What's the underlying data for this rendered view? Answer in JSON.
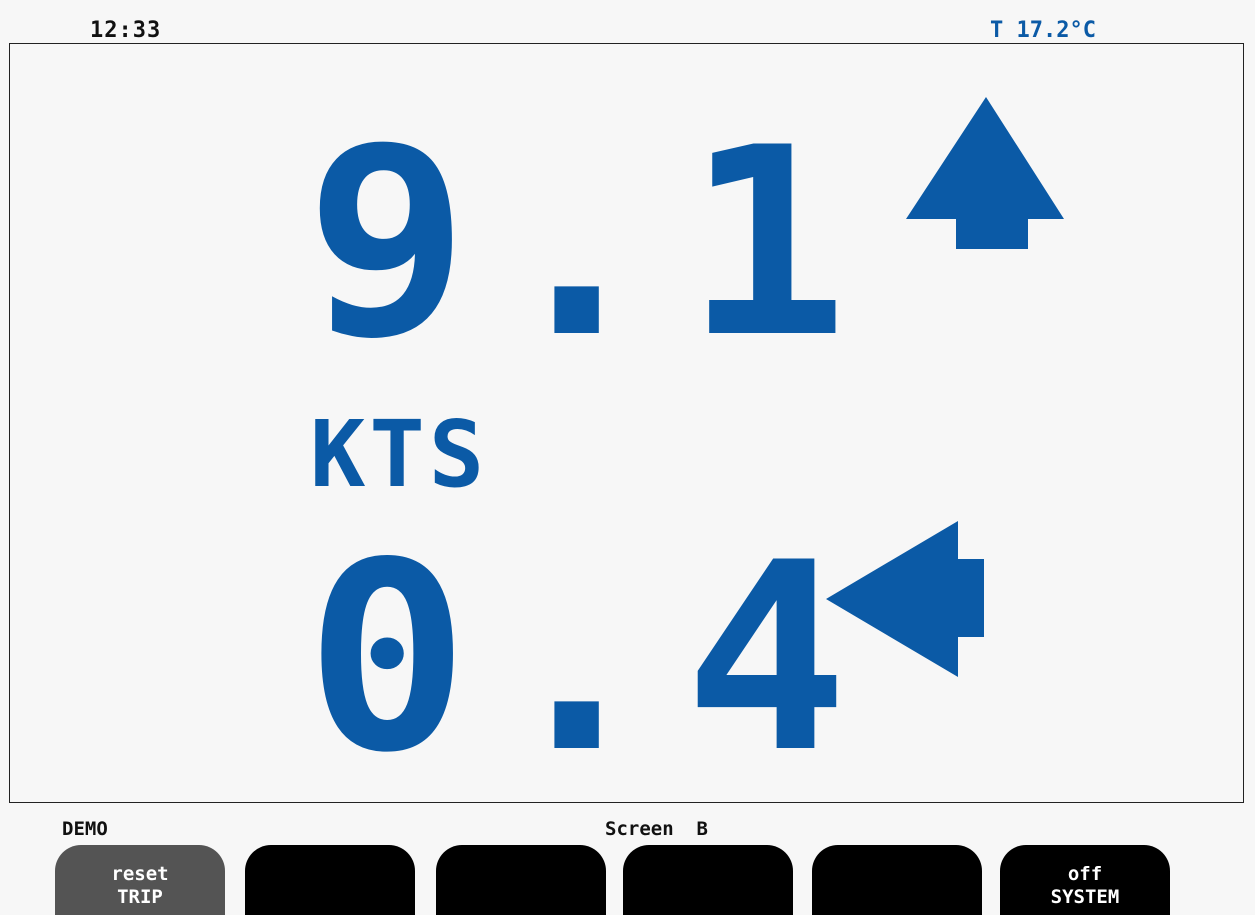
{
  "header": {
    "time": "12:33",
    "temperature": "T 17.2°C"
  },
  "display": {
    "speed": "9.1",
    "unit": "KTS",
    "drift": "0.4",
    "speed_arrow": "arrow-up-icon",
    "drift_arrow": "arrow-left-icon",
    "accent_color": "#0b5aa6"
  },
  "status": {
    "mode": "DEMO",
    "screen": "Screen  B"
  },
  "softkeys": [
    {
      "line1": "reset",
      "line2": "TRIP"
    },
    {
      "line1": "",
      "line2": ""
    },
    {
      "line1": "",
      "line2": ""
    },
    {
      "line1": "",
      "line2": ""
    },
    {
      "line1": "",
      "line2": ""
    },
    {
      "line1": "off",
      "line2": "SYSTEM"
    }
  ]
}
